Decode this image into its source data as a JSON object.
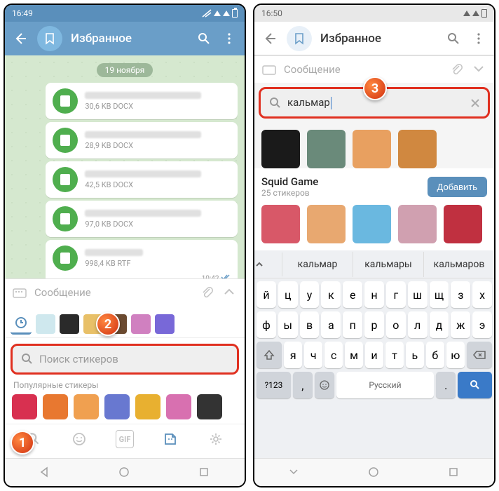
{
  "left": {
    "status_time": "16:49",
    "header_title": "Избранное",
    "date_chip": "19 ноября",
    "files": [
      {
        "size": "30,6 KB DOCX"
      },
      {
        "size": "28,9 KB DOCX"
      },
      {
        "size": "42,5 KB DOCX"
      },
      {
        "size": "97,0 KB DOCX"
      },
      {
        "size": "998,4 KB RTF"
      }
    ],
    "msg_time": "10:42",
    "input_placeholder": "Сообщение",
    "search_placeholder": "Поиск стикеров",
    "popular_label": "Популярные стикеры",
    "sticker_packs": [
      "#cfe8ee",
      "#2a2a2a",
      "#e8c068",
      "#6b4a30",
      "#d080c0",
      "#7868d8"
    ],
    "popular_stickers": [
      "#d83050",
      "#e87830",
      "#f0a050",
      "#6878d0",
      "#e8b030",
      "#d870b0",
      "#333"
    ]
  },
  "right": {
    "status_time": "16:50",
    "header_title": "Избранное",
    "input_placeholder": "Сообщение",
    "search_value": "кальмар",
    "result_stickers": [
      "#1a1a1a",
      "#6a8a7a",
      "#e8a060",
      "#d08840"
    ],
    "pack_name": "Squid Game",
    "pack_count": "25 стикеров",
    "add_label": "Добавить",
    "pack_stickers": [
      "#d85868",
      "#e8a870",
      "#6ab8e0",
      "#d0a0b0",
      "#c03040"
    ],
    "suggestions": [
      "кальмар",
      "кальмары",
      "кальмаров"
    ],
    "kb_row1": [
      "й",
      "ц",
      "у",
      "к",
      "е",
      "н",
      "г",
      "ш",
      "щ",
      "з",
      "х"
    ],
    "kb_row2": [
      "ф",
      "ы",
      "в",
      "а",
      "п",
      "р",
      "о",
      "л",
      "д",
      "ж",
      "э"
    ],
    "kb_row3": [
      "я",
      "ч",
      "с",
      "м",
      "и",
      "т",
      "ь",
      "б",
      "ю"
    ],
    "kb_sym": "?123",
    "kb_lang": "Русский"
  },
  "markers": {
    "m1": "1",
    "m2": "2",
    "m3": "3"
  }
}
